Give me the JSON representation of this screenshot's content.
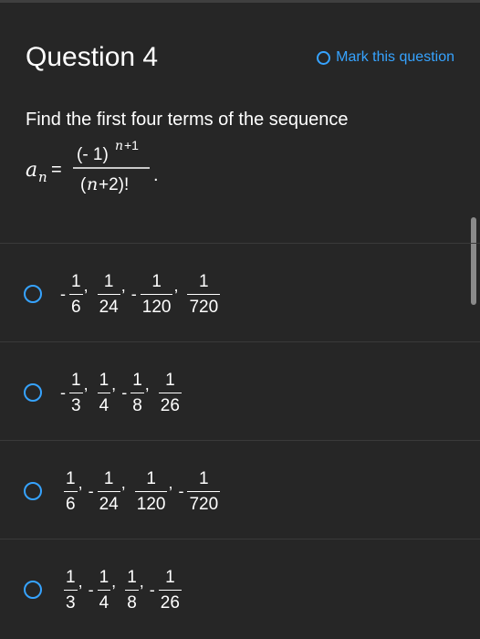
{
  "question": {
    "title": "Question 4",
    "mark_label": "Mark this question",
    "prompt": "Find the first four terms of the sequence"
  },
  "formula": {
    "lhs_var": "a",
    "lhs_sub": "n",
    "eq": "=",
    "num_base": "(- 1)",
    "num_exp_var": "n",
    "num_exp_rest": "+1",
    "den_open": "(",
    "den_var": "n",
    "den_rest": "+2)!",
    "period": "."
  },
  "options": [
    {
      "terms": [
        {
          "sign": "-",
          "num": "1",
          "den": "6"
        },
        {
          "sign": "",
          "num": "1",
          "den": "24"
        },
        {
          "sign": "-",
          "num": "1",
          "den": "120"
        },
        {
          "sign": "",
          "num": "1",
          "den": "720"
        }
      ]
    },
    {
      "terms": [
        {
          "sign": "-",
          "num": "1",
          "den": "3"
        },
        {
          "sign": "",
          "num": "1",
          "den": "4"
        },
        {
          "sign": "-",
          "num": "1",
          "den": "8"
        },
        {
          "sign": "",
          "num": "1",
          "den": "26"
        }
      ]
    },
    {
      "terms": [
        {
          "sign": "",
          "num": "1",
          "den": "6"
        },
        {
          "sign": "-",
          "num": "1",
          "den": "24"
        },
        {
          "sign": "",
          "num": "1",
          "den": "120"
        },
        {
          "sign": "-",
          "num": "1",
          "den": "720"
        }
      ]
    },
    {
      "terms": [
        {
          "sign": "",
          "num": "1",
          "den": "3"
        },
        {
          "sign": "-",
          "num": "1",
          "den": "4"
        },
        {
          "sign": "",
          "num": "1",
          "den": "8"
        },
        {
          "sign": "-",
          "num": "1",
          "den": "26"
        }
      ]
    }
  ],
  "colors": {
    "background": "#262626",
    "accent": "#36a3ff",
    "text": "#ffffff",
    "divider": "#3a3a3a"
  }
}
